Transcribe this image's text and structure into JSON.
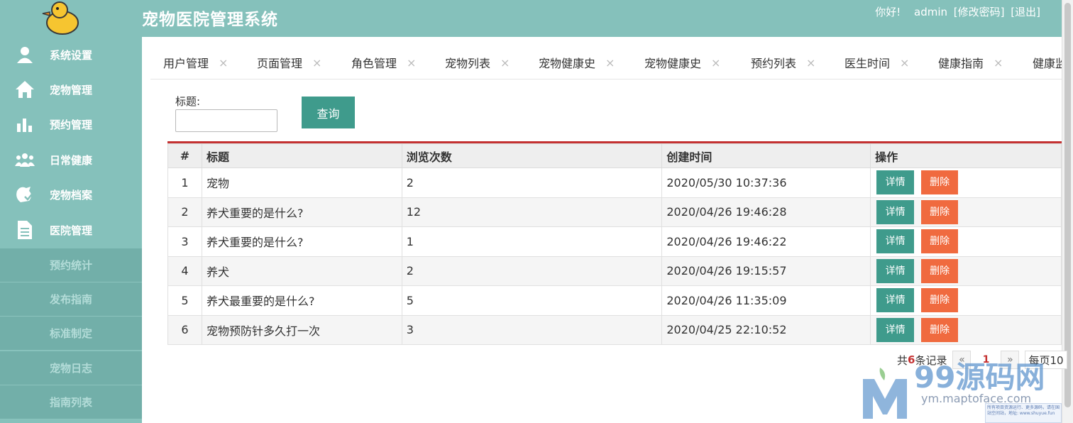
{
  "header": {
    "app_title": "宠物医院管理系统",
    "greeting": "你好!",
    "username": "admin",
    "change_password": "[修改密码]",
    "logout": "[退出]"
  },
  "sidebar": {
    "items": [
      {
        "label": "系统设置",
        "icon": "user-icon"
      },
      {
        "label": "宠物管理",
        "icon": "home-icon"
      },
      {
        "label": "预约管理",
        "icon": "bar-chart-icon"
      },
      {
        "label": "日常健康",
        "icon": "group-icon"
      },
      {
        "label": "宠物档案",
        "icon": "pet-file-icon"
      },
      {
        "label": "医院管理",
        "icon": "document-icon"
      }
    ],
    "subitems": [
      {
        "label": "预约统计"
      },
      {
        "label": "发布指南"
      },
      {
        "label": "标准制定"
      },
      {
        "label": "宠物日志"
      },
      {
        "label": "指南列表"
      }
    ]
  },
  "tabs": [
    {
      "label": "用户管理"
    },
    {
      "label": "页面管理"
    },
    {
      "label": "角色管理"
    },
    {
      "label": "宠物列表"
    },
    {
      "label": "宠物健康史"
    },
    {
      "label": "宠物健康史"
    },
    {
      "label": "预约列表"
    },
    {
      "label": "医生时间"
    },
    {
      "label": "健康指南"
    },
    {
      "label": "健康监"
    }
  ],
  "tab_close_glyph": "×",
  "search": {
    "label": "标题:",
    "value": "",
    "button": "查询"
  },
  "table": {
    "headers": [
      "#",
      "标题",
      "浏览次数",
      "创建时间",
      "操作"
    ],
    "rows": [
      {
        "num": "1",
        "title": "宠物",
        "views": "2",
        "created": "2020/05/30 10:37:36"
      },
      {
        "num": "2",
        "title": "养犬重要的是什么?",
        "views": "12",
        "created": "2020/04/26 19:46:28"
      },
      {
        "num": "3",
        "title": "养犬重要的是什么?",
        "views": "1",
        "created": "2020/04/26 19:46:22"
      },
      {
        "num": "4",
        "title": "养犬",
        "views": "2",
        "created": "2020/04/26 19:15:57"
      },
      {
        "num": "5",
        "title": "养犬最重要的是什么?",
        "views": "5",
        "created": "2020/04/26 11:35:09"
      },
      {
        "num": "6",
        "title": "宠物预防针多久打一次",
        "views": "3",
        "created": "2020/04/25 22:10:52"
      }
    ],
    "detail_label": "详情",
    "delete_label": "删除"
  },
  "pager": {
    "prefix": "共",
    "total": "6",
    "suffix": "条记录",
    "prev": "«",
    "current": "1",
    "next": "»",
    "page_size": "每页10"
  },
  "watermark": {
    "brand": "99源码网",
    "url": "ym.maptoface.com",
    "corner_text": "所有项目资源运行、更多源码，请在国站空间站，地址: www.shuyue.fun"
  },
  "colors": {
    "header_bg": "#85c1bb",
    "submenu_bg": "#72afa9",
    "primary_button": "#3f9b8c",
    "danger_button": "#f06a3f",
    "table_accent": "#c43131"
  }
}
